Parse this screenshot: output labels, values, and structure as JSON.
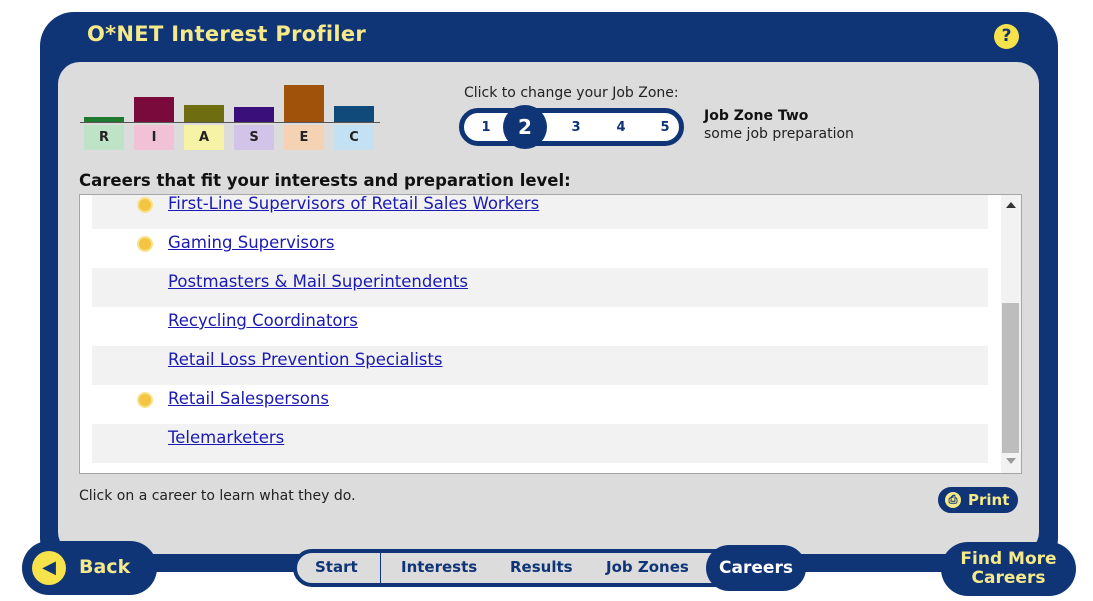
{
  "app": {
    "title": "O*NET Interest Profiler",
    "help_glyph": "?"
  },
  "interests": [
    {
      "letter": "R",
      "score": 4,
      "color": "#1e7a2e",
      "label_bg": "#bfe3c7"
    },
    {
      "letter": "I",
      "score": 20,
      "color": "#7a0a3c",
      "label_bg": "#f1c1d5"
    },
    {
      "letter": "A",
      "score": 14,
      "color": "#6e6e10",
      "label_bg": "#f6f2a6"
    },
    {
      "letter": "S",
      "score": 12,
      "color": "#3a0f7a",
      "label_bg": "#d2c3e8"
    },
    {
      "letter": "E",
      "score": 30,
      "color": "#a0510a",
      "label_bg": "#f6d2b4"
    },
    {
      "letter": "C",
      "score": 13,
      "color": "#0f4a7a",
      "label_bg": "#c4e1f3"
    }
  ],
  "job_zone": {
    "prompt": "Click to change your Job Zone:",
    "options": [
      "1",
      "2",
      "3",
      "4",
      "5"
    ],
    "selected": "2",
    "title": "Job Zone Two",
    "subtitle": "some job preparation"
  },
  "careers": {
    "heading": "Careers that fit your interests and preparation level:",
    "items": [
      {
        "name": "First-Line Supervisors of Retail Sales Workers",
        "bright_outlook": true
      },
      {
        "name": "Gaming Supervisors",
        "bright_outlook": true
      },
      {
        "name": "Postmasters & Mail Superintendents",
        "bright_outlook": false
      },
      {
        "name": "Recycling Coordinators",
        "bright_outlook": false
      },
      {
        "name": "Retail Loss Prevention Specialists",
        "bright_outlook": false
      },
      {
        "name": "Retail Salespersons",
        "bright_outlook": true
      },
      {
        "name": "Telemarketers",
        "bright_outlook": false
      }
    ],
    "hint": "Click on a career to learn what they do.",
    "print_label": "Print"
  },
  "nav": {
    "back_label": "Back",
    "tabs": [
      "Start",
      "Interests",
      "Results",
      "Job Zones"
    ],
    "active_tab": "Careers",
    "find_more_line1": "Find More",
    "find_more_line2": "Careers"
  }
}
